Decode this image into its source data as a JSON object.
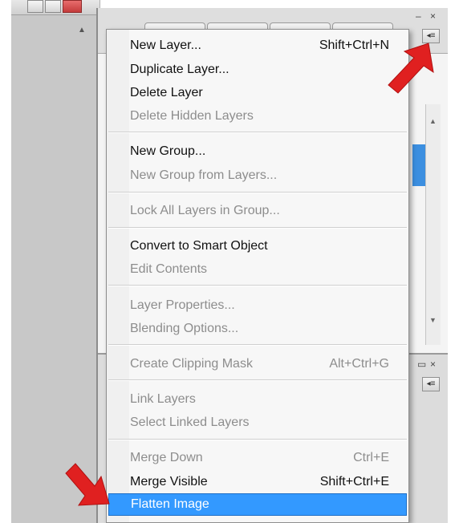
{
  "menu": {
    "items": [
      {
        "label": "New Layer...",
        "shortcut": "Shift+Ctrl+N",
        "enabled": true
      },
      {
        "label": "Duplicate Layer...",
        "shortcut": "",
        "enabled": true
      },
      {
        "label": "Delete Layer",
        "shortcut": "",
        "enabled": true
      },
      {
        "label": "Delete Hidden Layers",
        "shortcut": "",
        "enabled": false
      },
      {
        "label": "New Group...",
        "shortcut": "",
        "enabled": true
      },
      {
        "label": "New Group from Layers...",
        "shortcut": "",
        "enabled": false
      },
      {
        "label": "Lock All Layers in Group...",
        "shortcut": "",
        "enabled": false
      },
      {
        "label": "Convert to Smart Object",
        "shortcut": "",
        "enabled": true
      },
      {
        "label": "Edit Contents",
        "shortcut": "",
        "enabled": false
      },
      {
        "label": "Layer Properties...",
        "shortcut": "",
        "enabled": false
      },
      {
        "label": "Blending Options...",
        "shortcut": "",
        "enabled": false
      },
      {
        "label": "Create Clipping Mask",
        "shortcut": "Alt+Ctrl+G",
        "enabled": false
      },
      {
        "label": "Link Layers",
        "shortcut": "",
        "enabled": false
      },
      {
        "label": "Select Linked Layers",
        "shortcut": "",
        "enabled": false
      },
      {
        "label": "Merge Down",
        "shortcut": "Ctrl+E",
        "enabled": false
      },
      {
        "label": "Merge Visible",
        "shortcut": "Shift+Ctrl+E",
        "enabled": true
      },
      {
        "label": "Flatten Image",
        "shortcut": "",
        "enabled": true,
        "highlighted": true
      }
    ]
  },
  "panel": {
    "controls": {
      "minimize_icon": "–",
      "close_icon": "×"
    },
    "menu_button_icon": "flyout-menu-icon"
  },
  "annotations": {
    "arrow_color": "#e02020"
  },
  "colors": {
    "highlight": "#3399ff",
    "disabled_text": "#8d8d8d"
  }
}
